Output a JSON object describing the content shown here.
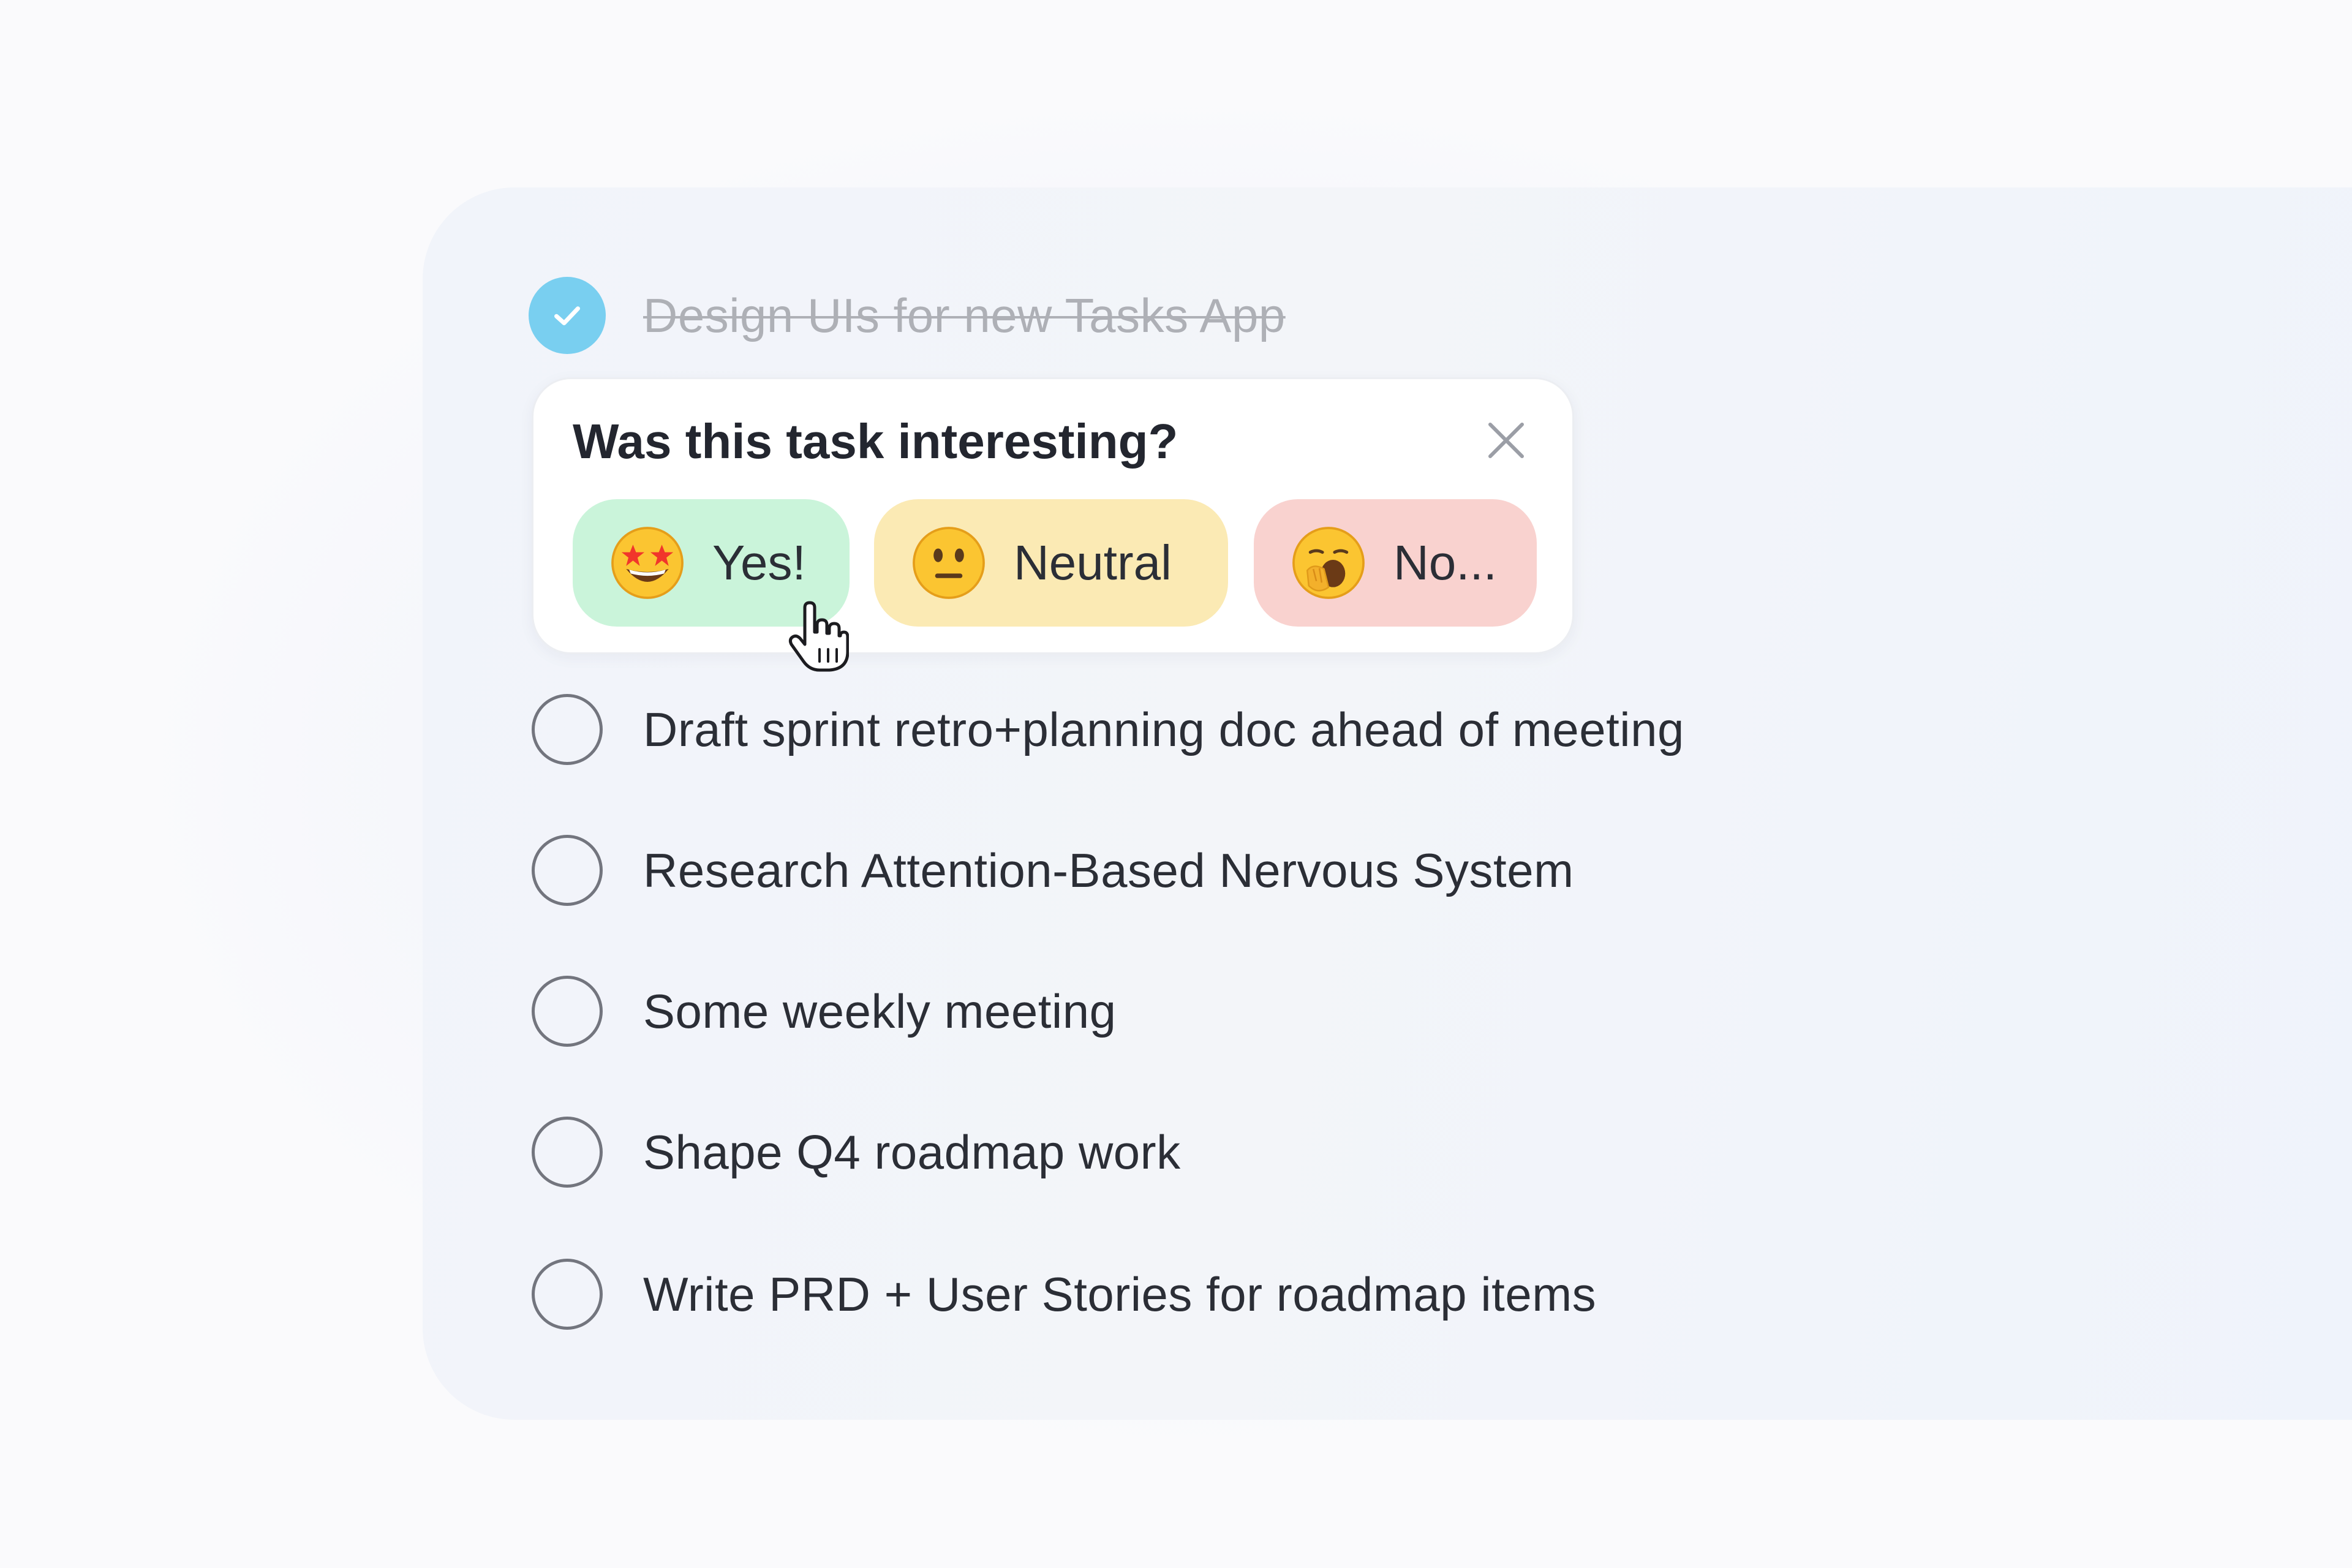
{
  "completed_task": {
    "label": "Design UIs for new Tasks App",
    "checked": true
  },
  "feedback_popup": {
    "title": "Was this task interesting?",
    "close_icon": "close-icon",
    "options": [
      {
        "emoji": "star-struck-emoji",
        "label": "Yes!",
        "color": "#caf4da"
      },
      {
        "emoji": "neutral-face-emoji",
        "label": "Neutral",
        "color": "#fbeab4"
      },
      {
        "emoji": "yawning-face-emoji",
        "label": "No...",
        "color": "#f9d2cf"
      }
    ]
  },
  "tasks": [
    {
      "label": "Draft sprint retro+planning doc ahead of meeting",
      "checked": false
    },
    {
      "label": "Research Attention-Based Nervous System",
      "checked": false
    },
    {
      "label": "Some weekly meeting",
      "checked": false
    },
    {
      "label": "Shape Q4 roadmap work",
      "checked": false
    },
    {
      "label": "Write PRD + User Stories for roadmap items",
      "checked": false
    }
  ],
  "colors": {
    "check_done": "#79cff0",
    "text": "#2b2e36",
    "text_done": "#aeb0b6"
  }
}
